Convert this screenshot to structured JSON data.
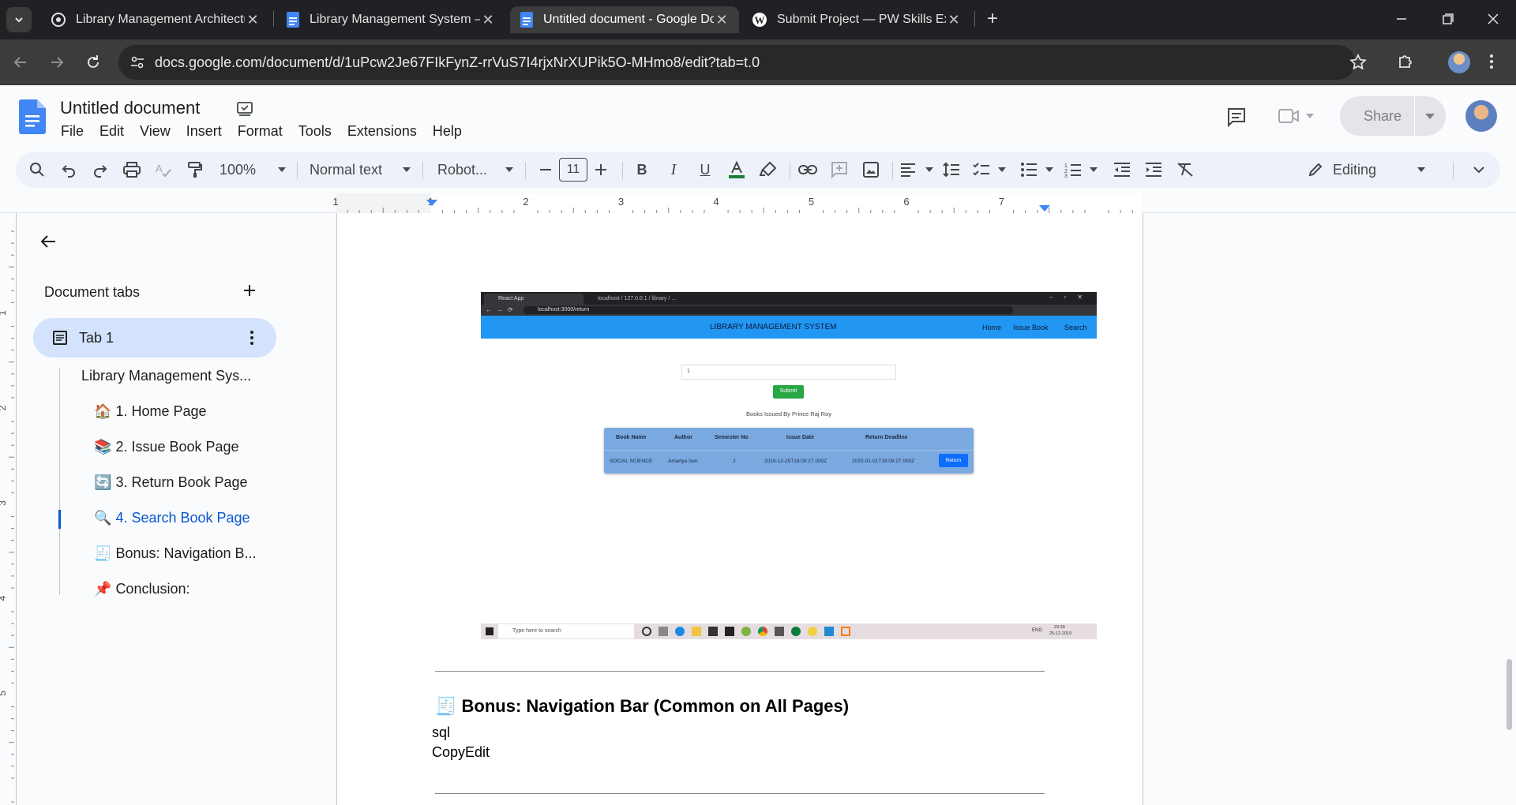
{
  "browser": {
    "tabs": [
      {
        "title": "Library Management Architectu",
        "icon": "chatgpt-icon"
      },
      {
        "title": "Library Management System – /",
        "icon": "google-docs-icon"
      },
      {
        "title": "Untitled document - Google Do",
        "icon": "google-docs-icon",
        "active": true
      },
      {
        "title": "Submit Project — PW Skills Exp",
        "icon": "wordpress-icon"
      }
    ],
    "url": "docs.google.com/document/d/1uPcw2Je67FIkFynZ-rrVuS7I4rjxNrXUPik5O-MHmo8/edit?tab=t.0"
  },
  "docs": {
    "title": "Untitled document",
    "menu": [
      "File",
      "Edit",
      "View",
      "Insert",
      "Format",
      "Tools",
      "Extensions",
      "Help"
    ],
    "share_label": "Share",
    "toolbar": {
      "zoom": "100%",
      "style": "Normal text",
      "font": "Robot...",
      "font_size": "11",
      "mode": "Editing"
    },
    "ruler_numbers": [
      "1",
      "1",
      "2",
      "3",
      "4",
      "5",
      "6",
      "7"
    ],
    "vruler_numbers": [
      "1",
      "2",
      "3",
      "4",
      "5"
    ]
  },
  "sidebar": {
    "heading": "Document tabs",
    "tab_label": "Tab 1",
    "outline": [
      {
        "emoji": "",
        "text": "Library Management Sys..."
      },
      {
        "emoji": "🏠",
        "text": "1. Home Page"
      },
      {
        "emoji": "📚",
        "text": "2. Issue Book Page"
      },
      {
        "emoji": "🔄",
        "text": "3. Return Book Page"
      },
      {
        "emoji": "🔍",
        "text": "4. Search Book Page",
        "active": true
      },
      {
        "emoji": "🧾",
        "text": "Bonus: Navigation B..."
      },
      {
        "emoji": "📌",
        "text": "Conclusion:"
      }
    ]
  },
  "document": {
    "embedded_screenshot": {
      "browser_tabs": [
        "React App",
        "localhost / 127.0.0.1 / library / ..."
      ],
      "url": "localhost:3000/return",
      "app_title": "LIBRARY MANAGEMENT SYSTEM",
      "nav": [
        "Home",
        "Issue Book",
        "Search"
      ],
      "input_value": "1",
      "submit_label": "Submit",
      "caption": "Books Issued By Prince Raj Roy",
      "table_headers": [
        "Book Name",
        "Author",
        "Semester No",
        "Issue Date",
        "Return Deadline"
      ],
      "table_row": [
        "SOCIAL SCIENCE",
        "Amartya Sen",
        "2",
        "2019-12-25T18:09:27.000Z",
        "2020-01-01T18:09:27.000Z"
      ],
      "return_label": "Return",
      "taskbar_search": "Type here to search",
      "taskbar_lang": "ENG",
      "taskbar_time": "23:39",
      "taskbar_date": "25-12-2019"
    },
    "heading": "Bonus: Navigation Bar (Common on All Pages)",
    "heading_emoji": "🧾",
    "line1": "sql",
    "line2": "CopyEdit"
  },
  "colors": {
    "app_blue": "#2196f3",
    "submit_green": "#28a745",
    "table_blue": "#7aa9e0",
    "docs_blue": "#0b57d0"
  }
}
